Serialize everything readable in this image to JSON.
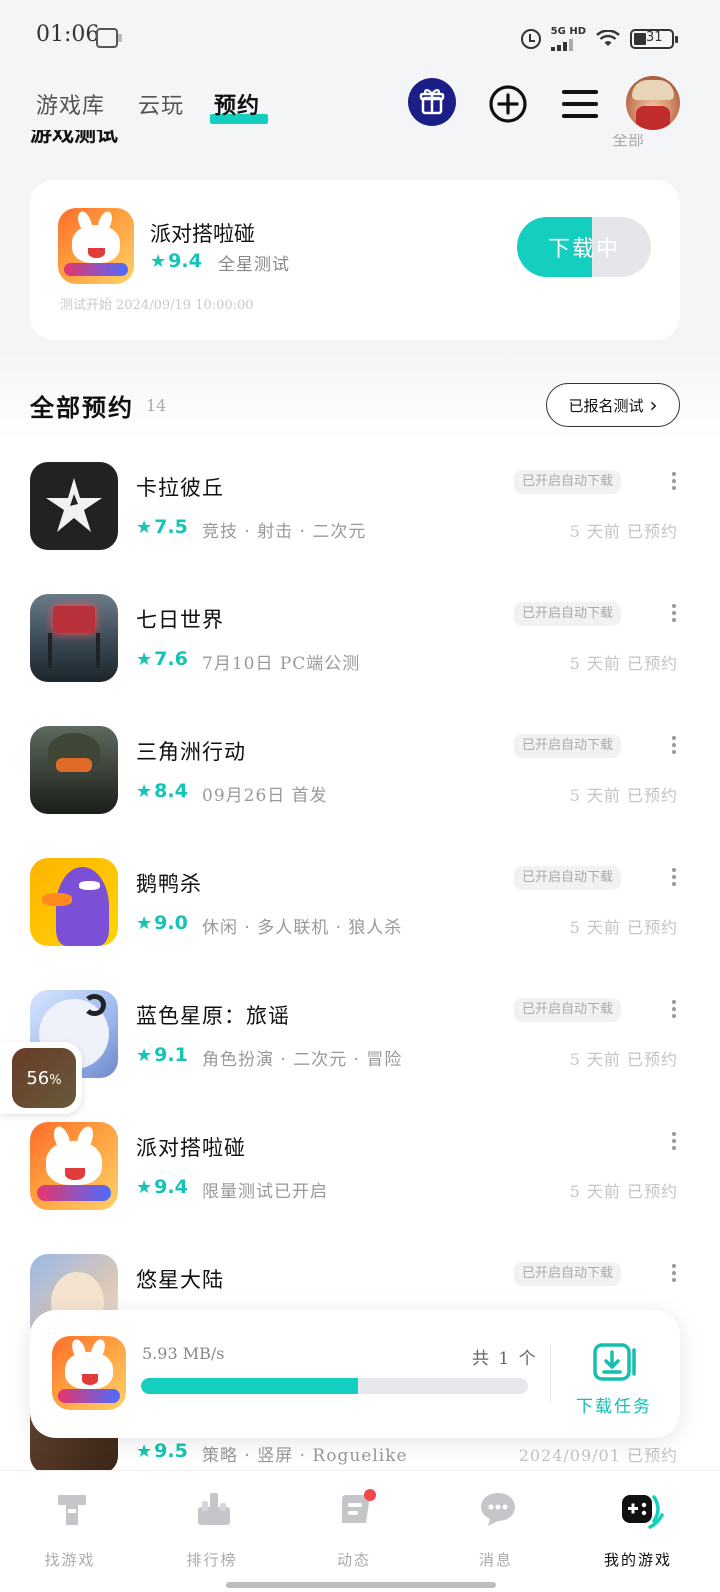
{
  "status_bar": {
    "time": "01:06",
    "network": "5G HD",
    "battery": "31"
  },
  "top_nav": {
    "tabs": [
      {
        "label": "游戏库",
        "active": false
      },
      {
        "label": "云玩",
        "active": false
      },
      {
        "label": "预约",
        "active": true
      }
    ]
  },
  "test_section": {
    "title": "游戏测试",
    "see_all": "全部",
    "card": {
      "name": "派对搭啦碰",
      "rating": "9.4",
      "tag": "全星测试",
      "start_time": "测试开始 2024/09/19 10:00:00",
      "button_label": "下载中",
      "progress": 0.56
    }
  },
  "all_section": {
    "title": "全部预约",
    "count": "14",
    "signed_button": "已报名测试"
  },
  "games": [
    {
      "name": "卡拉彼丘",
      "rating": "7.5",
      "desc": "竞技 · 射击 · 二次元",
      "badge": "已开启自动下载",
      "time": "5 天前 已预约"
    },
    {
      "name": "七日世界",
      "rating": "7.6",
      "desc": "7月10日 PC端公测",
      "badge": "已开启自动下载",
      "time": "5 天前 已预约"
    },
    {
      "name": "三角洲行动",
      "rating": "8.4",
      "desc": "09月26日 首发",
      "badge": "已开启自动下载",
      "time": "5 天前 已预约"
    },
    {
      "name": "鹅鸭杀",
      "rating": "9.0",
      "desc": "休闲 · 多人联机 · 狼人杀",
      "badge": "已开启自动下载",
      "time": "5 天前 已预约"
    },
    {
      "name": "蓝色星原：旅谣",
      "rating": "9.1",
      "desc": "角色扮演 · 二次元 · 冒险",
      "badge": "已开启自动下载",
      "time": "5 天前 已预约"
    },
    {
      "name": "派对搭啦碰",
      "rating": "9.4",
      "desc": "限量测试已开启",
      "badge": "",
      "time": "5 天前 已预约"
    },
    {
      "name": "悠星大陆",
      "rating": "",
      "desc": "",
      "badge": "已开启自动下载",
      "time": ""
    },
    {
      "name": "",
      "rating": "9.5",
      "desc": "策略 · 竖屏 · Roguelike",
      "badge": "",
      "time": "2024/09/01 已预约"
    }
  ],
  "float_progress": {
    "value": "56",
    "unit": "%"
  },
  "download_panel": {
    "speed": "5.93 MB/s",
    "total": "共 1 个",
    "progress": 0.56,
    "task_label": "下载任务"
  },
  "bottom_nav": [
    {
      "label": "找游戏",
      "icon": "find-game-icon",
      "active": false
    },
    {
      "label": "排行榜",
      "icon": "ranking-icon",
      "active": false
    },
    {
      "label": "动态",
      "icon": "feed-icon",
      "active": false
    },
    {
      "label": "消息",
      "icon": "message-icon",
      "active": false
    },
    {
      "label": "我的游戏",
      "icon": "gamepad-icon",
      "active": true
    }
  ],
  "colors": {
    "accent": "#14cfbf",
    "rating": "#14c4b4",
    "gift_bg": "#1b1e86",
    "notification_dot": "#f04848"
  }
}
